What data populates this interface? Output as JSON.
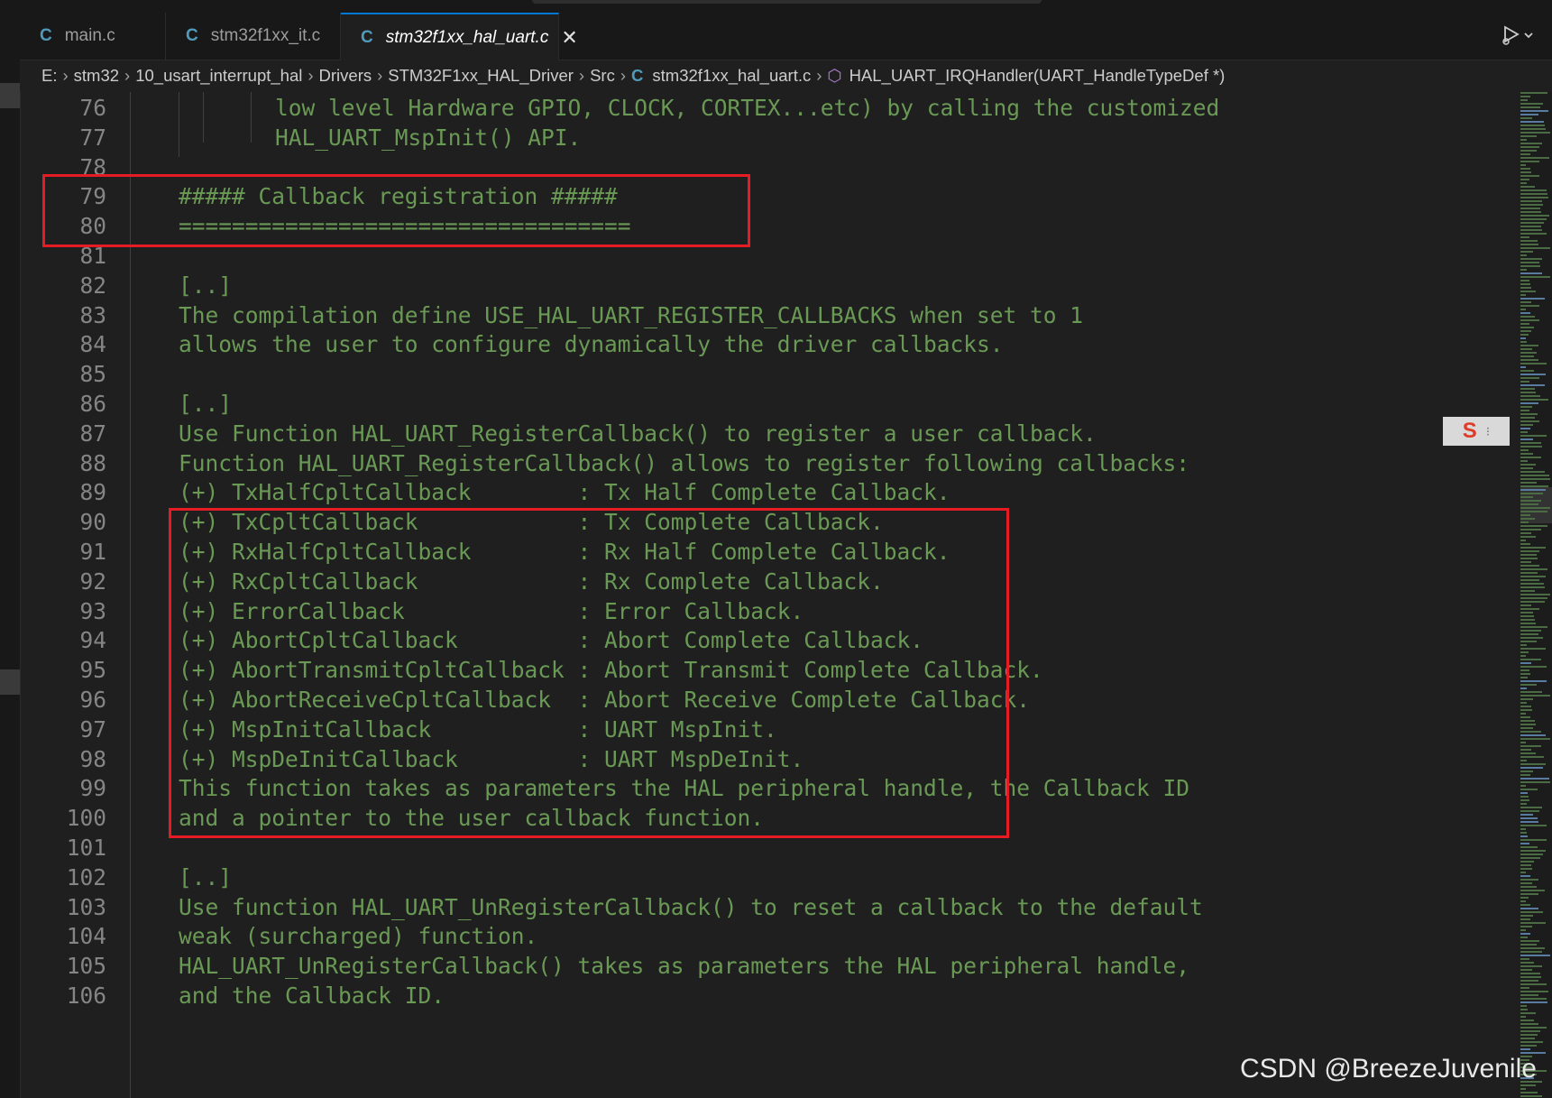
{
  "tabs": [
    {
      "label": "main.c",
      "icon": "c-file-icon"
    },
    {
      "label": "stm32f1xx_it.c",
      "icon": "c-file-icon"
    },
    {
      "label": "stm32f1xx_hal_uart.c",
      "icon": "c-file-icon",
      "active": true,
      "close": "✕"
    }
  ],
  "breadcrumb": [
    "E:",
    "stm32",
    "10_usart_interrupt_hal",
    "Drivers",
    "STM32F1xx_HAL_Driver",
    "Src",
    "stm32f1xx_hal_uart.c",
    "HAL_UART_IRQHandler(UART_HandleTypeDef *)"
  ],
  "editor": {
    "lines": [
      {
        "n": "76",
        "text": "low level Hardware GPIO, CLOCK, CORTEX...etc) by calling the customized"
      },
      {
        "n": "77",
        "text": "HAL_UART_MspInit() API."
      },
      {
        "n": "78",
        "text": ""
      },
      {
        "n": "79",
        "text": "##### Callback registration #####"
      },
      {
        "n": "80",
        "text": "=================================="
      },
      {
        "n": "81",
        "text": ""
      },
      {
        "n": "82",
        "text": "[..]"
      },
      {
        "n": "83",
        "text": "The compilation define USE_HAL_UART_REGISTER_CALLBACKS when set to 1"
      },
      {
        "n": "84",
        "text": "allows the user to configure dynamically the driver callbacks."
      },
      {
        "n": "85",
        "text": ""
      },
      {
        "n": "86",
        "text": "[..]"
      },
      {
        "n": "87",
        "text": "Use Function HAL_UART_RegisterCallback() to register a user callback."
      },
      {
        "n": "88",
        "text": "Function HAL_UART_RegisterCallback() allows to register following callbacks:"
      },
      {
        "n": "89",
        "text": "(+) TxHalfCpltCallback        : Tx Half Complete Callback."
      },
      {
        "n": "90",
        "text": "(+) TxCpltCallback            : Tx Complete Callback."
      },
      {
        "n": "91",
        "text": "(+) RxHalfCpltCallback        : Rx Half Complete Callback."
      },
      {
        "n": "92",
        "text": "(+) RxCpltCallback            : Rx Complete Callback."
      },
      {
        "n": "93",
        "text": "(+) ErrorCallback             : Error Callback."
      },
      {
        "n": "94",
        "text": "(+) AbortCpltCallback         : Abort Complete Callback."
      },
      {
        "n": "95",
        "text": "(+) AbortTransmitCpltCallback : Abort Transmit Complete Callback."
      },
      {
        "n": "96",
        "text": "(+) AbortReceiveCpltCallback  : Abort Receive Complete Callback."
      },
      {
        "n": "97",
        "text": "(+) MspInitCallback           : UART MspInit."
      },
      {
        "n": "98",
        "text": "(+) MspDeInitCallback         : UART MspDeInit."
      },
      {
        "n": "99",
        "text": "This function takes as parameters the HAL peripheral handle, the Callback ID"
      },
      {
        "n": "100",
        "text": "and a pointer to the user callback function."
      },
      {
        "n": "101",
        "text": ""
      },
      {
        "n": "102",
        "text": "[..]"
      },
      {
        "n": "103",
        "text": "Use function HAL_UART_UnRegisterCallback() to reset a callback to the default"
      },
      {
        "n": "104",
        "text": "weak (surcharged) function."
      },
      {
        "n": "105",
        "text": "HAL_UART_UnRegisterCallback() takes as parameters the HAL peripheral handle,"
      },
      {
        "n": "106",
        "text": "and the Callback ID."
      }
    ]
  },
  "watermark": "CSDN @BreezeJuvenile",
  "colors": {
    "comment": "#6a9955",
    "line_number": "#858585",
    "highlight_box": "#e51c23",
    "accent": "#0078d4"
  }
}
